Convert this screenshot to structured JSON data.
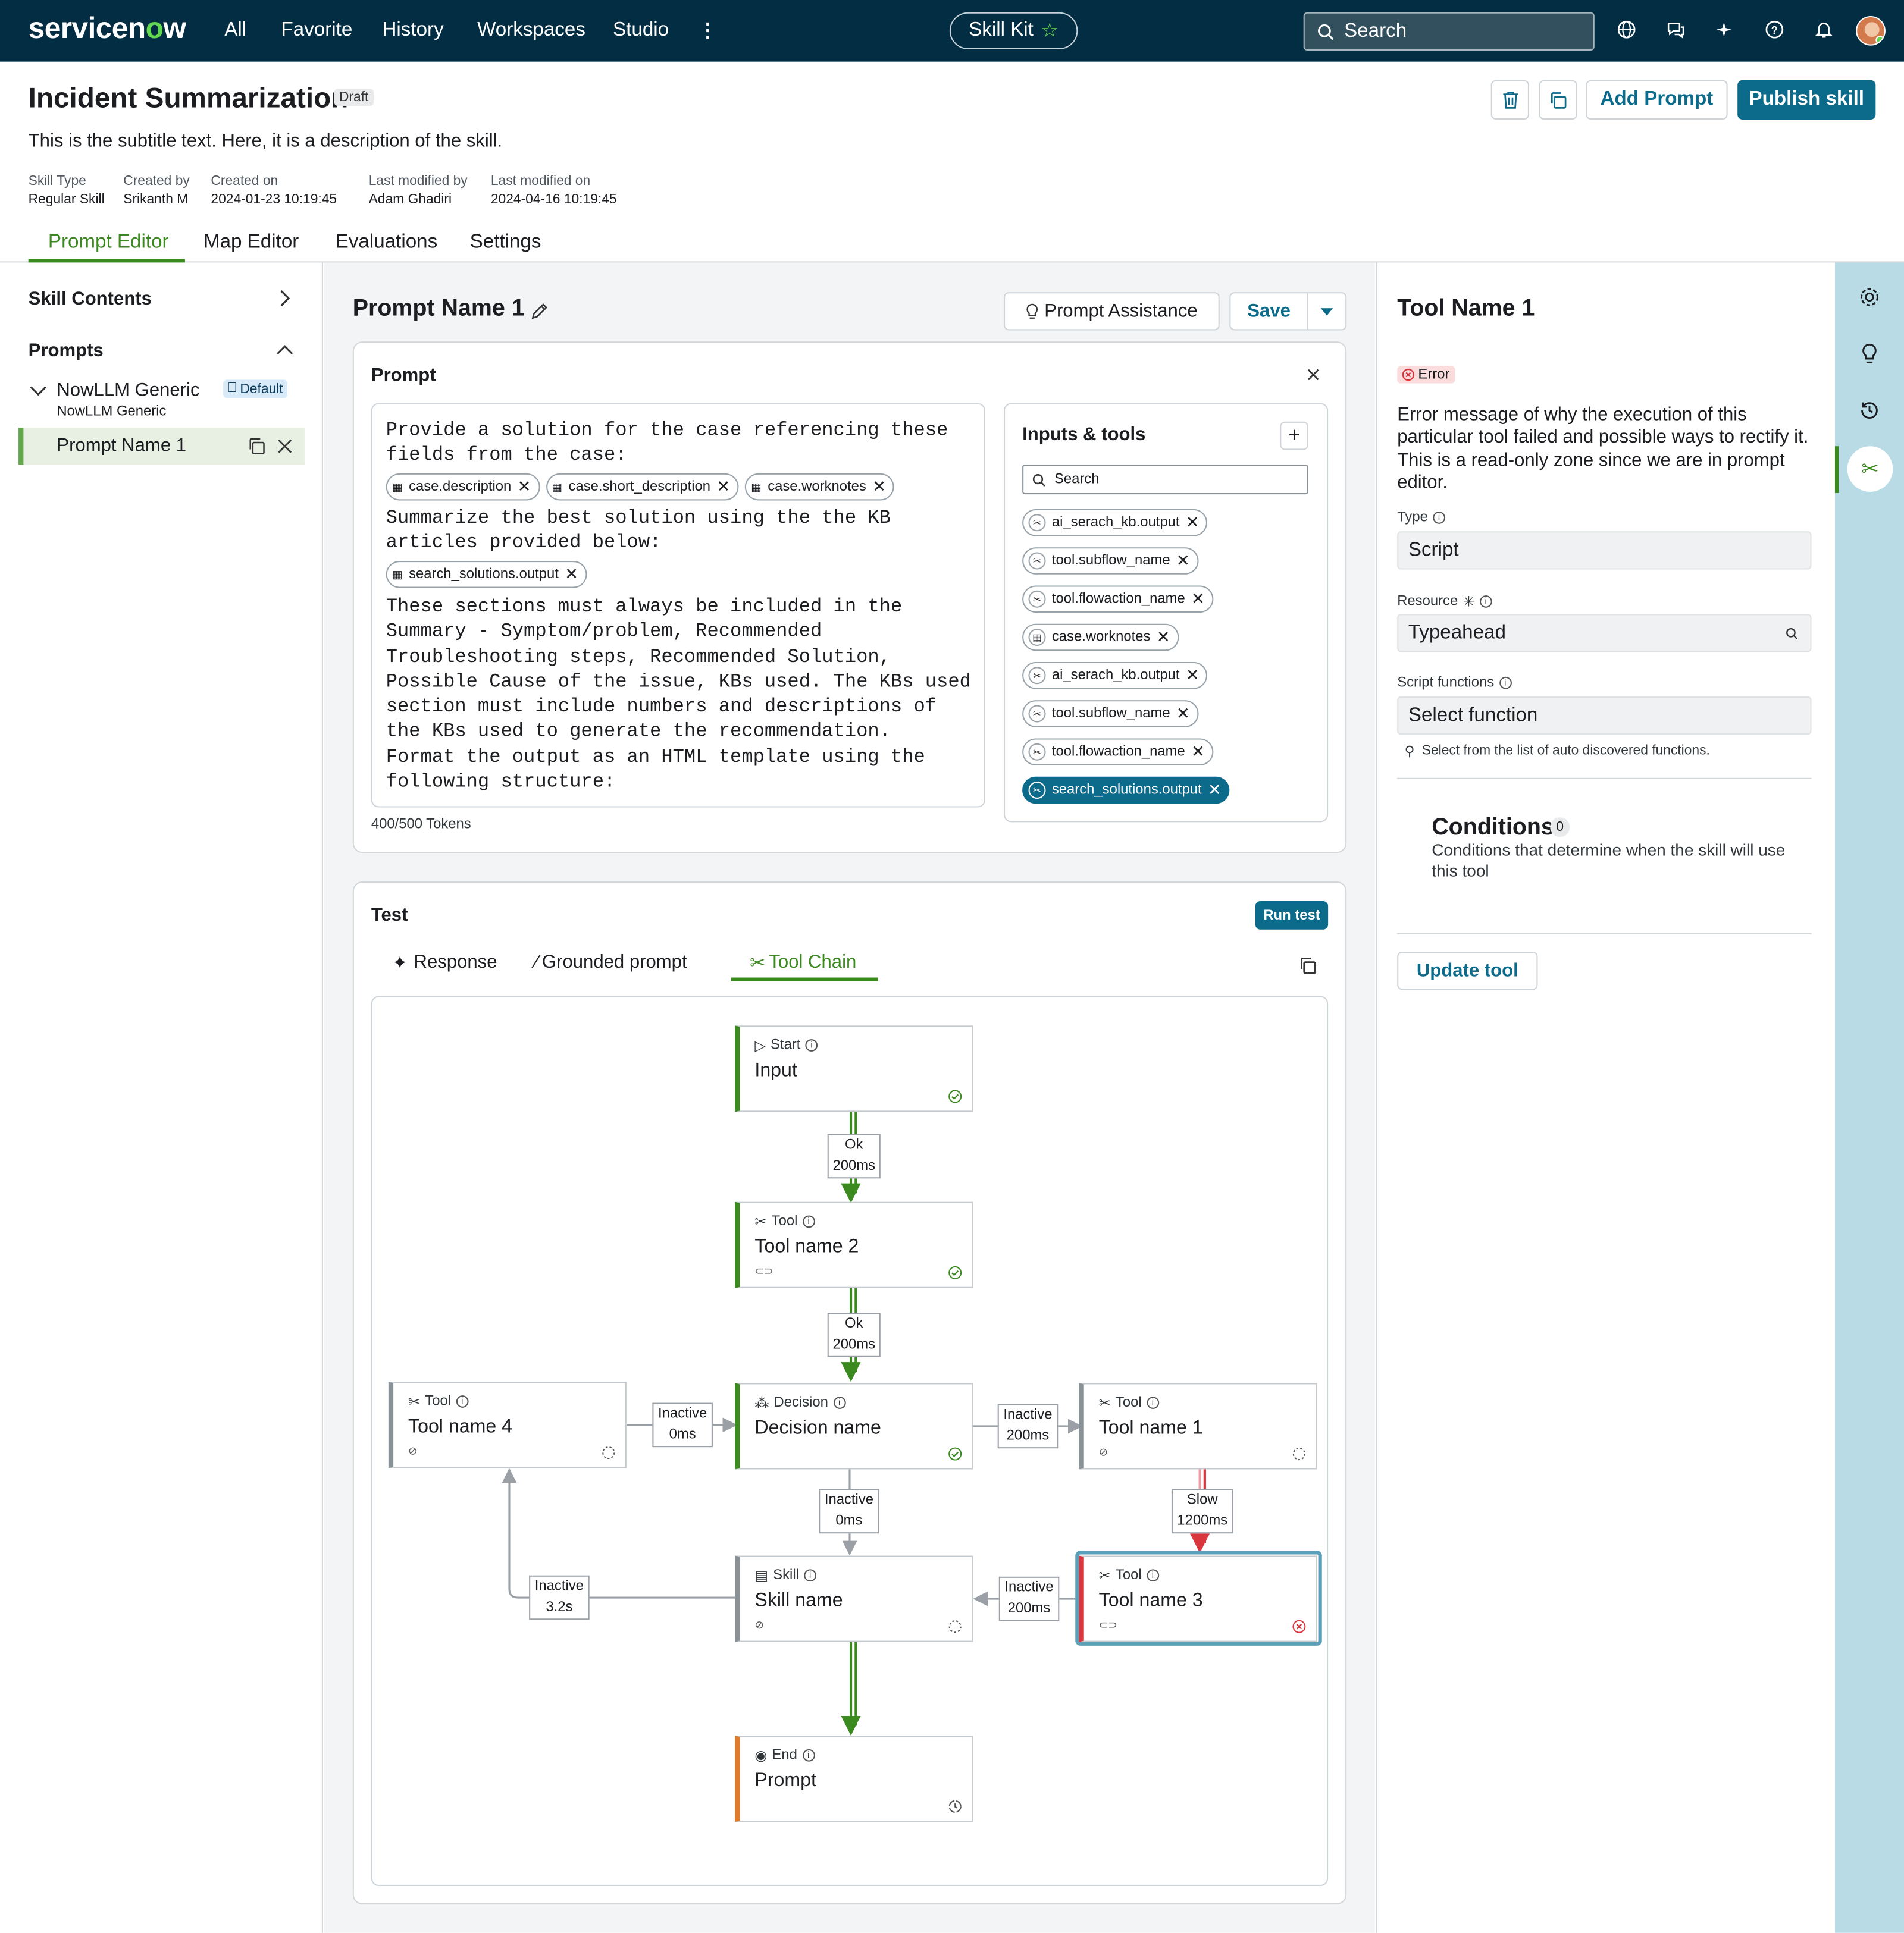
{
  "topnav": {
    "brand": "servicenow",
    "menu": [
      "All",
      "Favorite",
      "History",
      "Workspaces",
      "Studio"
    ],
    "skill_kit": "Skill Kit",
    "search_placeholder": "Search"
  },
  "header": {
    "title": "Incident Summarization",
    "status": "Draft",
    "subtitle": "This is the subtitle text. Here, it is a description of the skill.",
    "meta": [
      {
        "label": "Skill Type",
        "value": "Regular Skill"
      },
      {
        "label": "Created by",
        "value": "Srikanth M"
      },
      {
        "label": "Created on",
        "value": "2024-01-23 10:19:45"
      },
      {
        "label": "Last modified by",
        "value": "Adam Ghadiri"
      },
      {
        "label": "Last modified on",
        "value": "2024-04-16 10:19:45"
      }
    ],
    "add_prompt": "Add Prompt",
    "publish": "Publish skill"
  },
  "tabs": [
    "Prompt Editor",
    "Map Editor",
    "Evaluations",
    "Settings"
  ],
  "sidebar": {
    "skill_contents": "Skill Contents",
    "prompts": "Prompts",
    "group_name": "NowLLM Generic",
    "group_sub": "NowLLM Generic",
    "default_tag": "Default",
    "prompt_item": "Prompt Name 1"
  },
  "editor": {
    "prompt_name": "Prompt Name 1",
    "assist": "Prompt Assistance",
    "save": "Save",
    "prompt_label": "Prompt",
    "text1": "Provide a solution for the case referencing these\nfields from the case:",
    "chips1": [
      "case.description",
      "case.short_description",
      "case.worknotes"
    ],
    "text2": "Summarize the best solution using the the KB\narticles provided below:",
    "chips2": [
      "search_solutions.output"
    ],
    "text3": "These sections must always be included in the\nSummary - Symptom/problem, Recommended\nTroubleshooting steps, Recommended Solution,\nPossible Cause of the issue, KBs used. The KBs used\nsection must include numbers and descriptions of\nthe KBs used to generate the recommendation.\nFormat the output as an HTML template using the\nfollowing structure:",
    "tokens": "400/500 Tokens",
    "inputs_title": "Inputs & tools",
    "inputs_search": "Search",
    "inputs": [
      "ai_serach_kb.output",
      "tool.subflow_name",
      "tool.flowaction_name",
      "case.worknotes",
      "ai_serach_kb.output",
      "tool.subflow_name",
      "tool.flowaction_name",
      "search_solutions.output"
    ]
  },
  "test": {
    "label": "Test",
    "run": "Run test",
    "tabs": [
      "Response",
      "Grounded prompt",
      "Tool Chain"
    ],
    "nodes": {
      "start": {
        "type": "Start",
        "name": "Input"
      },
      "tool2": {
        "type": "Tool",
        "name": "Tool name 2"
      },
      "tool4": {
        "type": "Tool",
        "name": "Tool name 4"
      },
      "decision": {
        "type": "Decision",
        "name": "Decision name"
      },
      "tool1": {
        "type": "Tool",
        "name": "Tool name 1"
      },
      "skill": {
        "type": "Skill",
        "name": "Skill name"
      },
      "tool3": {
        "type": "Tool",
        "name": "Tool name 3"
      },
      "end": {
        "type": "End",
        "name": "Prompt"
      }
    },
    "edges": {
      "e1": {
        "status": "Ok",
        "time": "200ms"
      },
      "e2": {
        "status": "Ok",
        "time": "200ms"
      },
      "e3": {
        "status": "Inactive",
        "time": "0ms"
      },
      "e4": {
        "status": "Inactive",
        "time": "200ms"
      },
      "e5": {
        "status": "Inactive",
        "time": "0ms"
      },
      "e6": {
        "status": "Slow",
        "time": "1200ms"
      },
      "e7": {
        "status": "Inactive",
        "time": "3.2s"
      },
      "e8": {
        "status": "Inactive",
        "time": "200ms"
      }
    }
  },
  "tool_panel": {
    "title": "Tool Name 1",
    "status": "Error",
    "message": "Error message of why the execution of this particular tool failed and possible ways to rectify it. This is a read-only zone since we are in prompt editor.",
    "type_label": "Type",
    "type_value": "Script",
    "resource_label": "Resource",
    "resource_value": "Typeahead",
    "script_label": "Script functions",
    "script_value": "Select function",
    "script_hint": "Select from the list of auto discovered functions.",
    "conditions_title": "Conditions",
    "conditions_count": "0",
    "conditions_desc": "Conditions that determine when the skill will use this tool",
    "update": "Update tool"
  },
  "colors": {
    "nav": "#032d42",
    "primary": "#0c6a8a",
    "success": "#3a8a1f",
    "error": "#d9363e",
    "end": "#e07b2a"
  }
}
